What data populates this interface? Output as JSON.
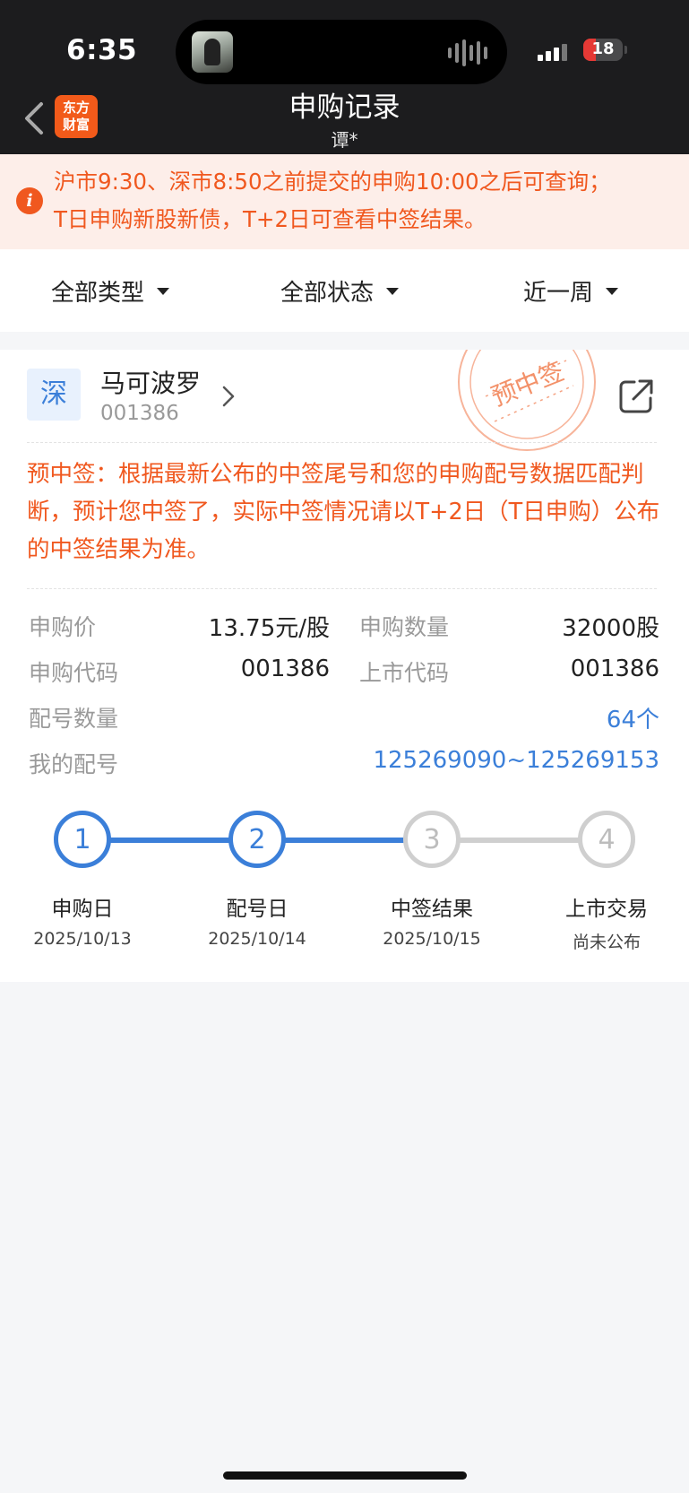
{
  "status_bar": {
    "time": "6:35",
    "battery": "18"
  },
  "nav": {
    "title": "申购记录",
    "subtitle": "谭*",
    "logo_line1": "东方",
    "logo_line2": "财富"
  },
  "notice": {
    "line1": "沪市9:30、深市8:50之前提交的申购10:00之后可查询；",
    "line2": "T日申购新股新债，T+2日可查看中签结果。"
  },
  "filters": [
    "全部类型",
    "全部状态",
    "近一周"
  ],
  "record": {
    "market": "深",
    "name": "马可波罗",
    "code": "001386",
    "stamp_text": "预中签",
    "win_text": "预中签：根据最新公布的中签尾号和您的申购配号数据匹配判断，预计您中签了，实际中签情况请以T+2日（T日申购）公布的中签结果为准。",
    "fields": {
      "price_label": "申购价",
      "price_value": "13.75元/股",
      "qty_label": "申购数量",
      "qty_value": "32000股",
      "sub_code_label": "申购代码",
      "sub_code_value": "001386",
      "list_code_label": "上市代码",
      "list_code_value": "001386",
      "alloc_count_label": "配号数量",
      "alloc_count_value": "64个",
      "my_alloc_label": "我的配号",
      "my_alloc_value": "125269090~125269153"
    },
    "steps": [
      {
        "num": "1",
        "label": "申购日",
        "date": "2025/10/13",
        "done": true
      },
      {
        "num": "2",
        "label": "配号日",
        "date": "2025/10/14",
        "done": true
      },
      {
        "num": "3",
        "label": "中签结果",
        "date": "2025/10/15",
        "done": false
      },
      {
        "num": "4",
        "label": "上市交易",
        "date": "尚未公布",
        "done": false
      }
    ]
  },
  "colors": {
    "accent": "#3b7fd9",
    "warning": "#f0581f",
    "nav_bg": "#1c1c1e"
  }
}
